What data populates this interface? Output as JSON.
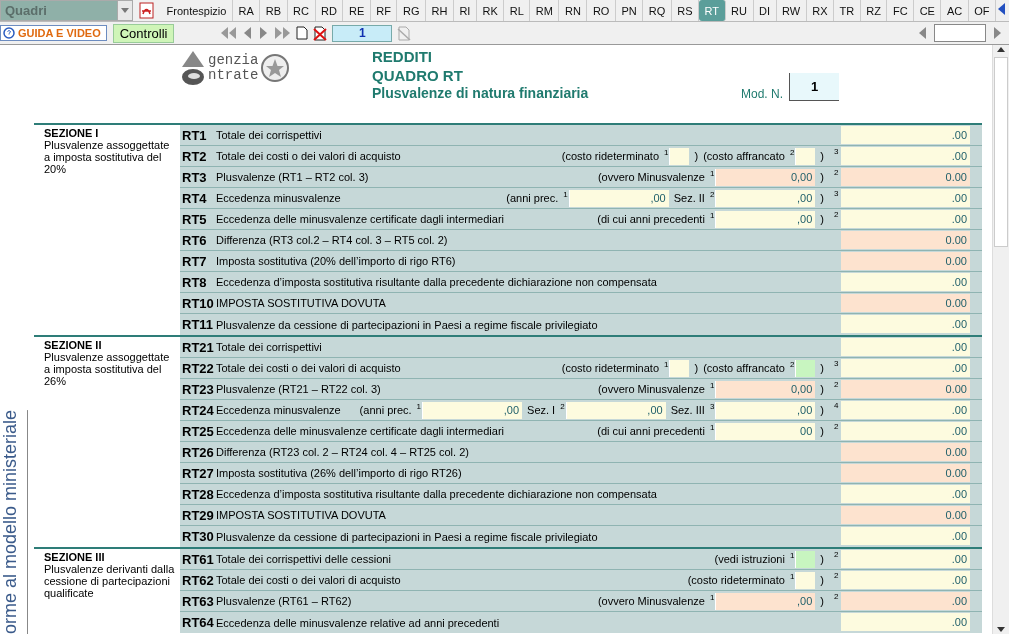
{
  "toolbar": {
    "dropdown": "Quadri",
    "tabs": [
      {
        "label": "Frontespizio",
        "selected": false
      },
      {
        "label": "RA",
        "selected": false
      },
      {
        "label": "RB",
        "selected": false
      },
      {
        "label": "RC",
        "selected": false
      },
      {
        "label": "RD",
        "selected": false
      },
      {
        "label": "RE",
        "selected": false
      },
      {
        "label": "RF",
        "selected": false
      },
      {
        "label": "RG",
        "selected": false
      },
      {
        "label": "RH",
        "selected": false
      },
      {
        "label": "RI",
        "selected": false
      },
      {
        "label": "RK",
        "selected": false
      },
      {
        "label": "RL",
        "selected": false
      },
      {
        "label": "RM",
        "selected": false
      },
      {
        "label": "RN",
        "selected": false
      },
      {
        "label": "RO",
        "selected": false
      },
      {
        "label": "PN",
        "selected": false
      },
      {
        "label": "RQ",
        "selected": false
      },
      {
        "label": "RS",
        "selected": false
      },
      {
        "label": "RT",
        "selected": true
      },
      {
        "label": "RU",
        "selected": false
      },
      {
        "label": "DI",
        "selected": false
      },
      {
        "label": "RW",
        "selected": false
      },
      {
        "label": "RX",
        "selected": false
      },
      {
        "label": "TR",
        "selected": false
      },
      {
        "label": "RZ",
        "selected": false
      },
      {
        "label": "FC",
        "selected": false
      },
      {
        "label": "CE",
        "selected": false
      },
      {
        "label": "AC",
        "selected": false
      },
      {
        "label": "OF",
        "selected": false
      }
    ]
  },
  "actionbar": {
    "guide_button": "GUIDA E VIDEO",
    "controls_button": "Controlli",
    "page": "1"
  },
  "header": {
    "logo_lines": [
      "genzia",
      "ntrate"
    ],
    "titles": [
      "REDDITI",
      "QUADRO RT",
      "Plusvalenze di natura finanziaria"
    ],
    "mod_label": "Mod. N.",
    "mod_value": "1"
  },
  "side_text": "orme al modello ministeriale",
  "sections": [
    {
      "title": "SEZIONE I",
      "description": "Plusvalenze assoggettate a imposta sostitutiva del 20%",
      "rows": [
        {
          "code": "RT1",
          "label": "Totale dei corrispettivi",
          "parts": [],
          "total": {
            "value": ".00",
            "color": "#fdfbdf"
          }
        },
        {
          "code": "RT2",
          "label": "Totale dei costi o dei valori di acquisto",
          "parts": [
            {
              "kind": "text",
              "text": "(costo rideterminato"
            },
            {
              "kind": "field",
              "num": "1",
              "color": "#fdfbdf"
            },
            {
              "kind": "text",
              "text": ")"
            },
            {
              "kind": "text",
              "text": "(costo affrancato"
            },
            {
              "kind": "field",
              "num": "2",
              "color": "#fdfbdf"
            },
            {
              "kind": "text",
              "text": ")"
            }
          ],
          "total": {
            "num": "3",
            "value": ".00",
            "color": "#fdfbdf"
          }
        },
        {
          "code": "RT3",
          "label": "Plusvalenze (RT1 – RT2 col. 3)",
          "parts": [
            {
              "kind": "text",
              "text": "(ovvero Minusvalenze"
            },
            {
              "kind": "field",
              "num": "1",
              "value": "0,00",
              "color": "#fde3cf"
            },
            {
              "kind": "text",
              "text": ")"
            }
          ],
          "total": {
            "num": "2",
            "value": "0.00",
            "color": "#fde3cf"
          }
        },
        {
          "code": "RT4",
          "label": "Eccedenza minusvalenze",
          "parts": [
            {
              "kind": "text",
              "text": "(anni prec."
            },
            {
              "kind": "field",
              "num": "1",
              "value": ",00",
              "color": "#fdfbdf"
            },
            {
              "kind": "text",
              "text": "Sez. II"
            },
            {
              "kind": "field",
              "num": "2",
              "value": ",00",
              "color": "#fdfbdf"
            },
            {
              "kind": "text",
              "text": ")"
            }
          ],
          "total": {
            "num": "3",
            "value": ".00",
            "color": "#fdfbdf"
          }
        },
        {
          "code": "RT5",
          "label": "Eccedenza delle minusvalenze certificate dagli intermediari",
          "parts": [
            {
              "kind": "text",
              "text": "(di cui anni precedenti"
            },
            {
              "kind": "field",
              "num": "1",
              "value": ",00",
              "color": "#fdfbdf"
            },
            {
              "kind": "text",
              "text": ")"
            }
          ],
          "total": {
            "num": "2",
            "value": ".00",
            "color": "#fdfbdf"
          }
        },
        {
          "code": "RT6",
          "label": "Differenza (RT3 col.2 – RT4 col. 3 – RT5 col. 2)",
          "parts": [],
          "total": {
            "value": "0.00",
            "color": "#fde3cf"
          }
        },
        {
          "code": "RT7",
          "label": "Imposta sostitutiva (20% dell’importo di rigo RT6)",
          "parts": [],
          "total": {
            "value": "0.00",
            "color": "#fde3cf"
          }
        },
        {
          "code": "RT8",
          "label": "Eccedenza d’imposta sostitutiva risultante dalla precedente dichiarazione non compensata",
          "parts": [],
          "total": {
            "value": ".00",
            "color": "#fdfbdf"
          }
        },
        {
          "code": "RT10",
          "label": "IMPOSTA SOSTITUTIVA DOVUTA",
          "parts": [],
          "total": {
            "value": "0.00",
            "color": "#fde3cf"
          }
        },
        {
          "code": "RT11",
          "label": "Plusvalenze da cessione di partecipazioni in Paesi a regime fiscale privilegiato",
          "parts": [],
          "total": {
            "value": ".00",
            "color": "#fdfbdf"
          }
        }
      ]
    },
    {
      "title": "SEZIONE II",
      "description": "Plusvalenze assoggettate a imposta sostitutiva del 26%",
      "rows": [
        {
          "code": "RT21",
          "label": "Totale dei corrispettivi",
          "parts": [],
          "total": {
            "value": ".00",
            "color": "#fdfbdf"
          }
        },
        {
          "code": "RT22",
          "label": "Totale dei costi o dei valori di acquisto",
          "parts": [
            {
              "kind": "text",
              "text": "(costo rideterminato"
            },
            {
              "kind": "field",
              "num": "1",
              "color": "#fdfbdf"
            },
            {
              "kind": "text",
              "text": ")"
            },
            {
              "kind": "text",
              "text": "(costo affrancato"
            },
            {
              "kind": "field",
              "num": "2",
              "color": "#c8f5c0"
            },
            {
              "kind": "text",
              "text": ")"
            }
          ],
          "total": {
            "num": "3",
            "value": ".00",
            "color": "#fdfbdf"
          }
        },
        {
          "code": "RT23",
          "label": "Plusvalenze (RT21 – RT22 col. 3)",
          "parts": [
            {
              "kind": "text",
              "text": "(ovvero Minusvalenze"
            },
            {
              "kind": "field",
              "num": "1",
              "value": "0,00",
              "color": "#fde3cf"
            },
            {
              "kind": "text",
              "text": ")"
            }
          ],
          "total": {
            "num": "2",
            "value": "0.00",
            "color": "#fde3cf"
          }
        },
        {
          "code": "RT24",
          "label": "Eccedenza minusvalenze",
          "parts": [
            {
              "kind": "text",
              "text": "(anni prec."
            },
            {
              "kind": "field",
              "num": "1",
              "value": ",00",
              "color": "#fdfbdf"
            },
            {
              "kind": "text",
              "text": "Sez. I"
            },
            {
              "kind": "field",
              "num": "2",
              "value": ",00",
              "color": "#fdfbdf"
            },
            {
              "kind": "text",
              "text": "Sez. III"
            },
            {
              "kind": "field",
              "num": "3",
              "value": ",00",
              "color": "#fdfbdf"
            },
            {
              "kind": "text",
              "text": ")"
            }
          ],
          "total": {
            "num": "4",
            "value": ".00",
            "color": "#fdfbdf"
          }
        },
        {
          "code": "RT25",
          "label": "Eccedenza delle minusvalenze certificate dagli intermediari",
          "parts": [
            {
              "kind": "text",
              "text": "(di cui anni precedenti"
            },
            {
              "kind": "field",
              "num": "1",
              "value": "00",
              "color": "#fdfbdf"
            },
            {
              "kind": "text",
              "text": ")"
            }
          ],
          "total": {
            "num": "2",
            "value": ".00",
            "color": "#fdfbdf"
          }
        },
        {
          "code": "RT26",
          "label": "Differenza (RT23 col. 2 – RT24 col. 4 – RT25 col. 2)",
          "parts": [],
          "total": {
            "value": "0.00",
            "color": "#fde3cf"
          }
        },
        {
          "code": "RT27",
          "label": "Imposta sostitutiva (26% dell’importo di rigo RT26)",
          "parts": [],
          "total": {
            "value": "0.00",
            "color": "#fde3cf"
          }
        },
        {
          "code": "RT28",
          "label": "Eccedenza d’imposta sostitutiva risultante dalla precedente dichiarazione non compensata",
          "parts": [],
          "total": {
            "value": ".00",
            "color": "#fdfbdf"
          }
        },
        {
          "code": "RT29",
          "label": "IMPOSTA SOSTITUTIVA DOVUTA",
          "parts": [],
          "total": {
            "value": "0.00",
            "color": "#fde3cf"
          }
        },
        {
          "code": "RT30",
          "label": "Plusvalenze da cessione di partecipazioni in Paesi a regime fiscale privilegiato",
          "parts": [],
          "total": {
            "value": ".00",
            "color": "#fdfbdf"
          }
        }
      ]
    },
    {
      "title": "SEZIONE III",
      "description": "Plusvalenze derivanti dalla cessione di partecipazioni qualificate",
      "rows": [
        {
          "code": "RT61",
          "label": "Totale dei corrispettivi delle cessioni",
          "parts": [
            {
              "kind": "text",
              "text": "(vedi istruzioni"
            },
            {
              "kind": "field",
              "num": "1",
              "color": "#c8f5c0"
            },
            {
              "kind": "text",
              "text": ")"
            }
          ],
          "total": {
            "num": "2",
            "value": ".00",
            "color": "#fdfbdf"
          }
        },
        {
          "code": "RT62",
          "label": "Totale dei costi o dei valori di acquisto",
          "parts": [
            {
              "kind": "text",
              "text": "(costo rideterminato"
            },
            {
              "kind": "field",
              "num": "1",
              "color": "#fdfbdf"
            },
            {
              "kind": "text",
              "text": ")"
            }
          ],
          "total": {
            "num": "2",
            "value": ".00",
            "color": "#fdfbdf"
          }
        },
        {
          "code": "RT63",
          "label": "Plusvalenze (RT61 – RT62)",
          "parts": [
            {
              "kind": "text",
              "text": "(ovvero Minusvalenze"
            },
            {
              "kind": "field",
              "num": "1",
              "value": ",00",
              "color": "#fde3cf"
            },
            {
              "kind": "text",
              "text": ")"
            }
          ],
          "total": {
            "num": "2",
            "value": ".00",
            "color": "#fde3cf"
          }
        },
        {
          "code": "RT64",
          "label": "Eccedenza delle minusvalenze relative ad anni precedenti",
          "parts": [],
          "total": {
            "value": ".00",
            "color": "#fdfbdf"
          }
        }
      ]
    }
  ]
}
